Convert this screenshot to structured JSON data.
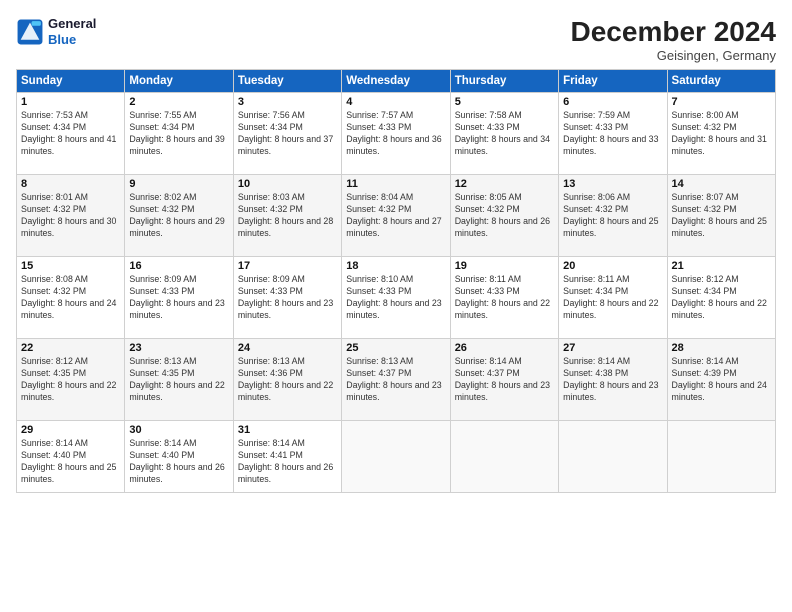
{
  "header": {
    "logo_line1": "General",
    "logo_line2": "Blue",
    "month_title": "December 2024",
    "location": "Geisingen, Germany"
  },
  "weekdays": [
    "Sunday",
    "Monday",
    "Tuesday",
    "Wednesday",
    "Thursday",
    "Friday",
    "Saturday"
  ],
  "weeks": [
    [
      {
        "day": "1",
        "sunrise": "Sunrise: 7:53 AM",
        "sunset": "Sunset: 4:34 PM",
        "daylight": "Daylight: 8 hours and 41 minutes."
      },
      {
        "day": "2",
        "sunrise": "Sunrise: 7:55 AM",
        "sunset": "Sunset: 4:34 PM",
        "daylight": "Daylight: 8 hours and 39 minutes."
      },
      {
        "day": "3",
        "sunrise": "Sunrise: 7:56 AM",
        "sunset": "Sunset: 4:34 PM",
        "daylight": "Daylight: 8 hours and 37 minutes."
      },
      {
        "day": "4",
        "sunrise": "Sunrise: 7:57 AM",
        "sunset": "Sunset: 4:33 PM",
        "daylight": "Daylight: 8 hours and 36 minutes."
      },
      {
        "day": "5",
        "sunrise": "Sunrise: 7:58 AM",
        "sunset": "Sunset: 4:33 PM",
        "daylight": "Daylight: 8 hours and 34 minutes."
      },
      {
        "day": "6",
        "sunrise": "Sunrise: 7:59 AM",
        "sunset": "Sunset: 4:33 PM",
        "daylight": "Daylight: 8 hours and 33 minutes."
      },
      {
        "day": "7",
        "sunrise": "Sunrise: 8:00 AM",
        "sunset": "Sunset: 4:32 PM",
        "daylight": "Daylight: 8 hours and 31 minutes."
      }
    ],
    [
      {
        "day": "8",
        "sunrise": "Sunrise: 8:01 AM",
        "sunset": "Sunset: 4:32 PM",
        "daylight": "Daylight: 8 hours and 30 minutes."
      },
      {
        "day": "9",
        "sunrise": "Sunrise: 8:02 AM",
        "sunset": "Sunset: 4:32 PM",
        "daylight": "Daylight: 8 hours and 29 minutes."
      },
      {
        "day": "10",
        "sunrise": "Sunrise: 8:03 AM",
        "sunset": "Sunset: 4:32 PM",
        "daylight": "Daylight: 8 hours and 28 minutes."
      },
      {
        "day": "11",
        "sunrise": "Sunrise: 8:04 AM",
        "sunset": "Sunset: 4:32 PM",
        "daylight": "Daylight: 8 hours and 27 minutes."
      },
      {
        "day": "12",
        "sunrise": "Sunrise: 8:05 AM",
        "sunset": "Sunset: 4:32 PM",
        "daylight": "Daylight: 8 hours and 26 minutes."
      },
      {
        "day": "13",
        "sunrise": "Sunrise: 8:06 AM",
        "sunset": "Sunset: 4:32 PM",
        "daylight": "Daylight: 8 hours and 25 minutes."
      },
      {
        "day": "14",
        "sunrise": "Sunrise: 8:07 AM",
        "sunset": "Sunset: 4:32 PM",
        "daylight": "Daylight: 8 hours and 25 minutes."
      }
    ],
    [
      {
        "day": "15",
        "sunrise": "Sunrise: 8:08 AM",
        "sunset": "Sunset: 4:32 PM",
        "daylight": "Daylight: 8 hours and 24 minutes."
      },
      {
        "day": "16",
        "sunrise": "Sunrise: 8:09 AM",
        "sunset": "Sunset: 4:33 PM",
        "daylight": "Daylight: 8 hours and 23 minutes."
      },
      {
        "day": "17",
        "sunrise": "Sunrise: 8:09 AM",
        "sunset": "Sunset: 4:33 PM",
        "daylight": "Daylight: 8 hours and 23 minutes."
      },
      {
        "day": "18",
        "sunrise": "Sunrise: 8:10 AM",
        "sunset": "Sunset: 4:33 PM",
        "daylight": "Daylight: 8 hours and 23 minutes."
      },
      {
        "day": "19",
        "sunrise": "Sunrise: 8:11 AM",
        "sunset": "Sunset: 4:33 PM",
        "daylight": "Daylight: 8 hours and 22 minutes."
      },
      {
        "day": "20",
        "sunrise": "Sunrise: 8:11 AM",
        "sunset": "Sunset: 4:34 PM",
        "daylight": "Daylight: 8 hours and 22 minutes."
      },
      {
        "day": "21",
        "sunrise": "Sunrise: 8:12 AM",
        "sunset": "Sunset: 4:34 PM",
        "daylight": "Daylight: 8 hours and 22 minutes."
      }
    ],
    [
      {
        "day": "22",
        "sunrise": "Sunrise: 8:12 AM",
        "sunset": "Sunset: 4:35 PM",
        "daylight": "Daylight: 8 hours and 22 minutes."
      },
      {
        "day": "23",
        "sunrise": "Sunrise: 8:13 AM",
        "sunset": "Sunset: 4:35 PM",
        "daylight": "Daylight: 8 hours and 22 minutes."
      },
      {
        "day": "24",
        "sunrise": "Sunrise: 8:13 AM",
        "sunset": "Sunset: 4:36 PM",
        "daylight": "Daylight: 8 hours and 22 minutes."
      },
      {
        "day": "25",
        "sunrise": "Sunrise: 8:13 AM",
        "sunset": "Sunset: 4:37 PM",
        "daylight": "Daylight: 8 hours and 23 minutes."
      },
      {
        "day": "26",
        "sunrise": "Sunrise: 8:14 AM",
        "sunset": "Sunset: 4:37 PM",
        "daylight": "Daylight: 8 hours and 23 minutes."
      },
      {
        "day": "27",
        "sunrise": "Sunrise: 8:14 AM",
        "sunset": "Sunset: 4:38 PM",
        "daylight": "Daylight: 8 hours and 23 minutes."
      },
      {
        "day": "28",
        "sunrise": "Sunrise: 8:14 AM",
        "sunset": "Sunset: 4:39 PM",
        "daylight": "Daylight: 8 hours and 24 minutes."
      }
    ],
    [
      {
        "day": "29",
        "sunrise": "Sunrise: 8:14 AM",
        "sunset": "Sunset: 4:40 PM",
        "daylight": "Daylight: 8 hours and 25 minutes."
      },
      {
        "day": "30",
        "sunrise": "Sunrise: 8:14 AM",
        "sunset": "Sunset: 4:40 PM",
        "daylight": "Daylight: 8 hours and 26 minutes."
      },
      {
        "day": "31",
        "sunrise": "Sunrise: 8:14 AM",
        "sunset": "Sunset: 4:41 PM",
        "daylight": "Daylight: 8 hours and 26 minutes."
      },
      null,
      null,
      null,
      null
    ]
  ]
}
